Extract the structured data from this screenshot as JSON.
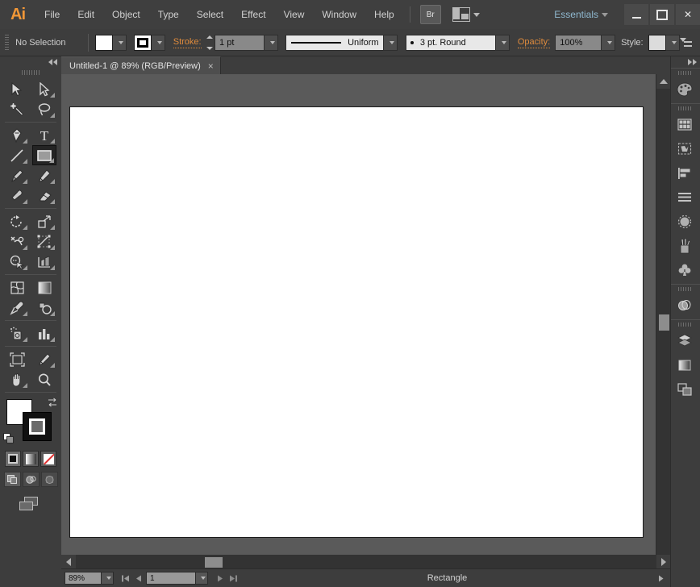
{
  "app": {
    "logo": "Ai",
    "menus": [
      "File",
      "Edit",
      "Object",
      "Type",
      "Select",
      "Effect",
      "View",
      "Window",
      "Help"
    ],
    "bridge_label": "Br",
    "workspace": "Essentials",
    "window_controls": {
      "minimize": "—",
      "maximize": "□",
      "close": "✕"
    }
  },
  "control_bar": {
    "selection_status": "No Selection",
    "stroke_label": "Stroke:",
    "stroke_weight": "1 pt",
    "profile": "Uniform",
    "brush": "3 pt. Round",
    "opacity_label": "Opacity:",
    "opacity_value": "100%",
    "style_label": "Style:",
    "fill_color": "#ffffff",
    "stroke_color": "#000000",
    "accent_color": "#e08b3c"
  },
  "toolbar": {
    "tools": [
      {
        "name": "selection-tool",
        "row": 0,
        "col": 0
      },
      {
        "name": "direct-selection-tool",
        "row": 0,
        "col": 1
      },
      {
        "name": "magic-wand-tool",
        "row": 1,
        "col": 0
      },
      {
        "name": "lasso-tool",
        "row": 1,
        "col": 1
      },
      {
        "name": "pen-tool",
        "row": 2,
        "col": 0
      },
      {
        "name": "type-tool",
        "row": 2,
        "col": 1
      },
      {
        "name": "line-segment-tool",
        "row": 3,
        "col": 0
      },
      {
        "name": "rectangle-tool",
        "row": 3,
        "col": 1,
        "selected": true
      },
      {
        "name": "paintbrush-tool",
        "row": 4,
        "col": 0
      },
      {
        "name": "pencil-tool",
        "row": 4,
        "col": 1
      },
      {
        "name": "blob-brush-tool",
        "row": 5,
        "col": 0
      },
      {
        "name": "eraser-tool",
        "row": 5,
        "col": 1
      },
      {
        "name": "rotate-tool",
        "row": 6,
        "col": 0
      },
      {
        "name": "scale-tool",
        "row": 6,
        "col": 1
      },
      {
        "name": "width-tool",
        "row": 7,
        "col": 0
      },
      {
        "name": "free-transform-tool",
        "row": 7,
        "col": 1
      },
      {
        "name": "shape-builder-tool",
        "row": 8,
        "col": 0
      },
      {
        "name": "perspective-grid-tool",
        "row": 8,
        "col": 1
      },
      {
        "name": "mesh-tool",
        "row": 9,
        "col": 0
      },
      {
        "name": "gradient-tool",
        "row": 9,
        "col": 1
      },
      {
        "name": "eyedropper-tool",
        "row": 10,
        "col": 0
      },
      {
        "name": "blend-tool",
        "row": 10,
        "col": 1
      },
      {
        "name": "symbol-sprayer-tool",
        "row": 11,
        "col": 0
      },
      {
        "name": "column-graph-tool",
        "row": 11,
        "col": 1
      },
      {
        "name": "artboard-tool",
        "row": 12,
        "col": 0
      },
      {
        "name": "slice-tool",
        "row": 12,
        "col": 1
      },
      {
        "name": "hand-tool",
        "row": 13,
        "col": 0
      },
      {
        "name": "zoom-tool",
        "row": 13,
        "col": 1
      }
    ],
    "fill_color": "#ffffff",
    "stroke_color": "#000000",
    "color_modes": [
      "color",
      "gradient",
      "none"
    ],
    "draw_modes": [
      "draw-normal",
      "draw-behind",
      "draw-inside"
    ],
    "active_draw_mode": "draw-normal"
  },
  "document": {
    "tab_title": "Untitled-1 @ 89% (RGB/Preview)",
    "close_glyph": "×",
    "canvas_bg": "#5a5a5a",
    "artboard_bg": "#ffffff"
  },
  "status_bar": {
    "zoom_level": "89%",
    "page_number": "1",
    "status_text": "Rectangle"
  },
  "right_dock": {
    "panels": [
      {
        "name": "color-panel",
        "group": 0
      },
      {
        "name": "swatches-panel",
        "group": 1
      },
      {
        "name": "symbols-panel",
        "group": 1
      },
      {
        "name": "align-panel",
        "group": 1
      },
      {
        "name": "stroke-panel",
        "group": 1
      },
      {
        "name": "transparency-panel",
        "group": 1
      },
      {
        "name": "brushes-panel",
        "group": 1
      },
      {
        "name": "graphic-styles-panel",
        "group": 1
      },
      {
        "name": "appearance-panel",
        "group": 2
      },
      {
        "name": "layers-panel",
        "group": 3
      },
      {
        "name": "gradient-panel",
        "group": 3
      },
      {
        "name": "artboards-panel",
        "group": 3
      }
    ]
  }
}
